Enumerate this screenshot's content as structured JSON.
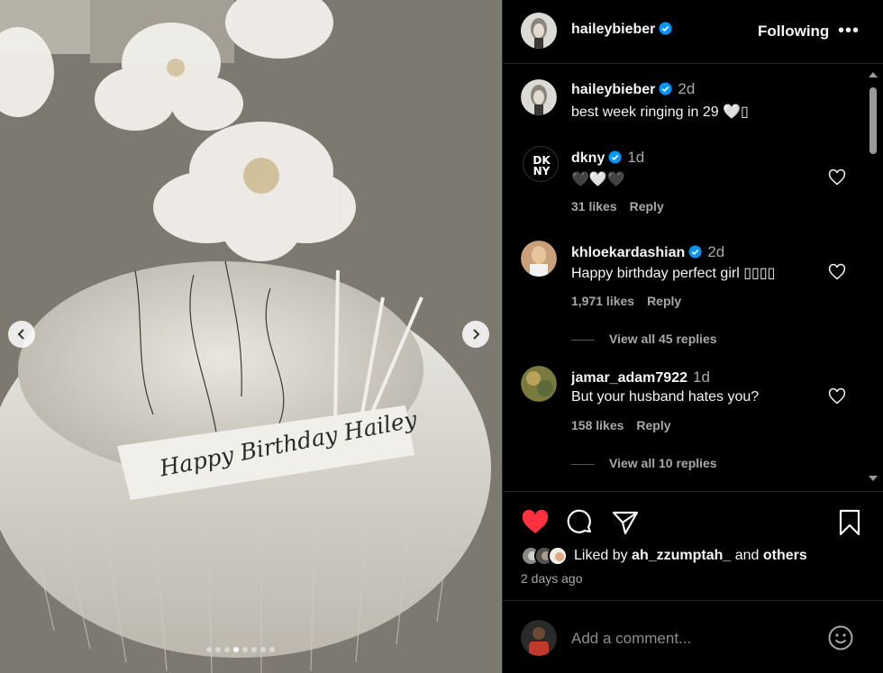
{
  "media": {
    "cake_text": "Happy Birthday Hailey",
    "slide_count": 8,
    "active_slide": 4
  },
  "header": {
    "username": "haileybieber",
    "follow_label": "Following",
    "more_label": "•••"
  },
  "caption": {
    "username": "haileybieber",
    "time": "2d",
    "text": "best week ringing in 29 🤍▯"
  },
  "comments": [
    {
      "username": "dkny",
      "time": "1d",
      "text": "🖤🤍🖤",
      "likes": "31 likes",
      "reply": "Reply",
      "avatar_text": "DK NY"
    },
    {
      "username": "khloekardashian",
      "time": "2d",
      "text": "Happy birthday perfect girl ▯▯▯▯",
      "likes": "1,971 likes",
      "reply": "Reply",
      "view_replies": "View all 45 replies"
    },
    {
      "username": "jamar_adam7922",
      "time": "1d",
      "text": "But your husband hates you?",
      "likes": "158 likes",
      "reply": "Reply",
      "view_replies": "View all 10 replies"
    }
  ],
  "likes_bar": {
    "liked_by_prefix": "Liked by",
    "liked_by_user": "ah_zzumptah_",
    "and": "and",
    "others": "others"
  },
  "date": "2 days ago",
  "add_comment": {
    "placeholder": "Add a comment..."
  },
  "colors": {
    "background": "#000000",
    "text": "#f5f5f5",
    "muted": "#a8a8a8",
    "verified": "#0095f6",
    "like_red": "#ff3040"
  }
}
